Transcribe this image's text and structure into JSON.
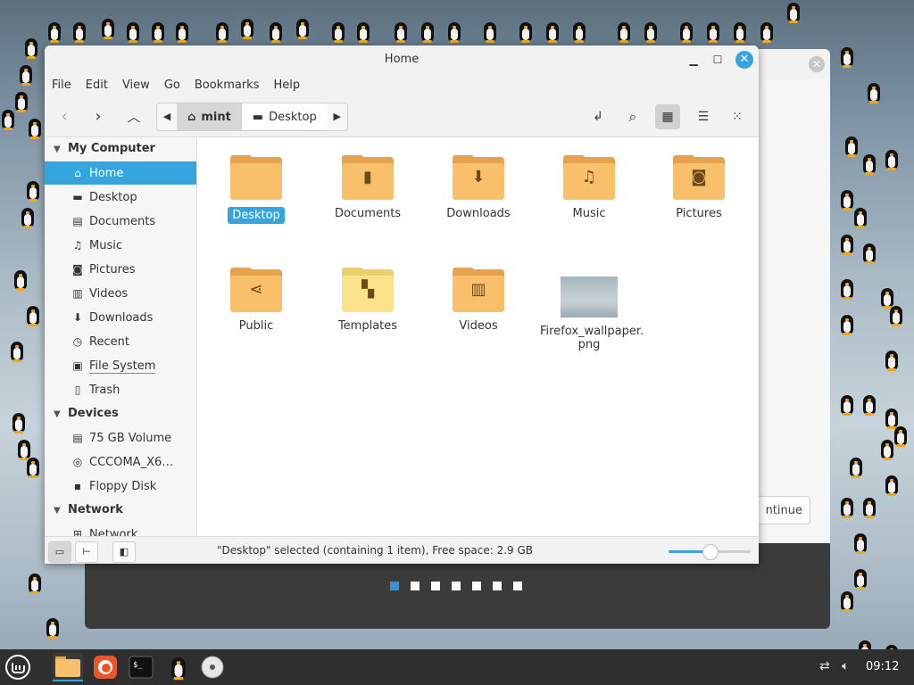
{
  "window": {
    "title": "Home",
    "minimize_icon": "minimize-icon",
    "maximize_icon": "maximize-icon",
    "close_icon": "close-icon"
  },
  "menu": [
    "File",
    "Edit",
    "View",
    "Go",
    "Bookmarks",
    "Help"
  ],
  "toolbar": {
    "path": [
      "mint",
      "Desktop"
    ],
    "icons": [
      "back-icon",
      "forward-icon",
      "up-icon",
      "toggle-location-icon",
      "search-icon",
      "grid-view-icon",
      "list-view-icon",
      "compact-view-icon"
    ]
  },
  "sidebar": {
    "sections": [
      {
        "title": "My Computer",
        "items": [
          {
            "label": "Home",
            "icon": "home-icon",
            "active": true
          },
          {
            "label": "Desktop",
            "icon": "desktop-icon"
          },
          {
            "label": "Documents",
            "icon": "documents-icon"
          },
          {
            "label": "Music",
            "icon": "music-icon"
          },
          {
            "label": "Pictures",
            "icon": "pictures-icon"
          },
          {
            "label": "Videos",
            "icon": "videos-icon"
          },
          {
            "label": "Downloads",
            "icon": "downloads-icon"
          },
          {
            "label": "Recent",
            "icon": "recent-icon"
          },
          {
            "label": "File System",
            "icon": "filesystem-icon"
          },
          {
            "label": "Trash",
            "icon": "trash-icon"
          }
        ]
      },
      {
        "title": "Devices",
        "items": [
          {
            "label": "75 GB Volume",
            "icon": "drive-icon"
          },
          {
            "label": "CCCOMA_X6…",
            "icon": "optical-disc-icon"
          },
          {
            "label": "Floppy Disk",
            "icon": "floppy-icon"
          }
        ]
      },
      {
        "title": "Network",
        "items": [
          {
            "label": "Network",
            "icon": "network-icon"
          }
        ]
      }
    ]
  },
  "files": [
    {
      "name": "Desktop",
      "type": "folder",
      "selected": true
    },
    {
      "name": "Documents",
      "type": "folder-documents"
    },
    {
      "name": "Downloads",
      "type": "folder-downloads"
    },
    {
      "name": "Music",
      "type": "folder-music"
    },
    {
      "name": "Pictures",
      "type": "folder-pictures"
    },
    {
      "name": "Public",
      "type": "folder-public"
    },
    {
      "name": "Templates",
      "type": "folder-templates"
    },
    {
      "name": "Videos",
      "type": "folder-videos"
    },
    {
      "name": "Firefox_wallpaper.\npng",
      "type": "image"
    }
  ],
  "statusbar": {
    "text": "\"Desktop\" selected (containing 1 item), Free space: 2.9 GB",
    "zoom_fraction": 0.5
  },
  "background_dialog": {
    "continue_label": "ntinue",
    "page_count": 7,
    "active_page": 1
  },
  "taskbar": {
    "clock": "09:12",
    "apps": [
      "mint-menu-icon",
      "files-icon",
      "firefox-icon",
      "terminal-icon",
      "tux-icon",
      "disc-icon"
    ],
    "tray": [
      "network-icon",
      "volume-icon"
    ]
  },
  "colors": {
    "accent": "#35a5e0",
    "folder": "#f8c06a"
  }
}
